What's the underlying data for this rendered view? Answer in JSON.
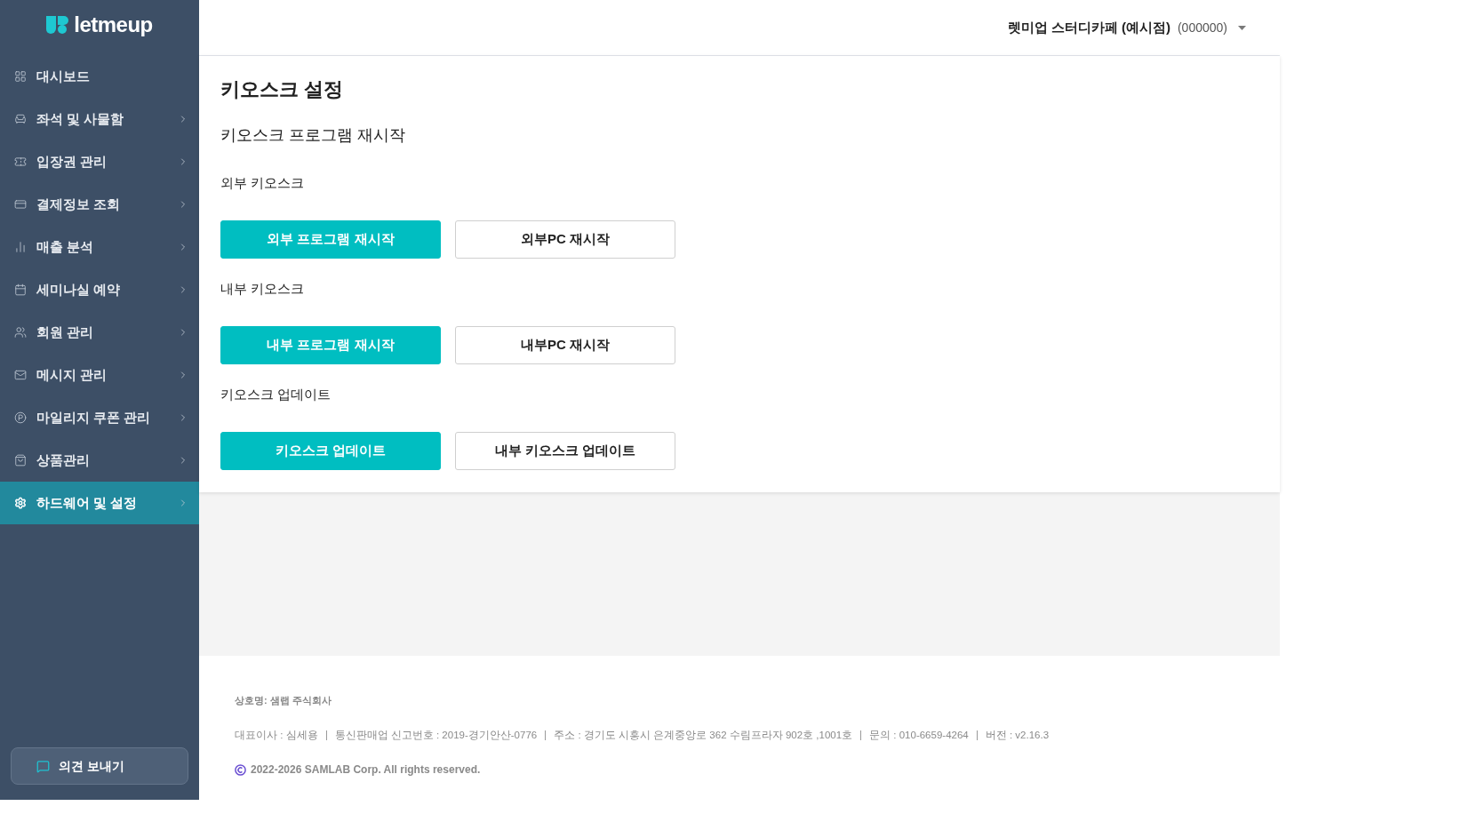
{
  "sidebar": {
    "logo": {
      "text": "letmeup"
    },
    "items": [
      {
        "label": "대시보드",
        "kind": "link",
        "selected": false
      },
      {
        "label": "좌석 및 사물함",
        "kind": "group",
        "selected": false
      },
      {
        "label": "입장권 관리",
        "kind": "group",
        "selected": false
      },
      {
        "label": "결제정보 조회",
        "kind": "group",
        "selected": false
      },
      {
        "label": "매출 분석",
        "kind": "group",
        "selected": false
      },
      {
        "label": "세미나실 예약",
        "kind": "group",
        "selected": false
      },
      {
        "label": "회원 관리",
        "kind": "group",
        "selected": false
      },
      {
        "label": "메시지 관리",
        "kind": "group",
        "selected": false
      },
      {
        "label": "마일리지 쿠폰 관리",
        "kind": "group",
        "selected": false
      },
      {
        "label": "상품관리",
        "kind": "group",
        "selected": false
      },
      {
        "label": "하드웨어 및 설정",
        "kind": "group",
        "selected": true
      }
    ],
    "feedback_button": {
      "label": "의견 보내기"
    }
  },
  "header": {
    "store_name": "렛미업 스터디카페 (예시점)",
    "store_code": "(000000)"
  },
  "page": {
    "title": "키오스크 설정",
    "subtitle": "키오스크 프로그램 재시작",
    "sections": [
      {
        "label": "외부 키오스크",
        "buttons": [
          {
            "label": "외부 프로그램 재시작",
            "kind": "primary"
          },
          {
            "label": "외부PC 재시작",
            "kind": "outline"
          }
        ]
      },
      {
        "label": "내부 키오스크",
        "buttons": [
          {
            "label": "내부 프로그램 재시작",
            "kind": "primary"
          },
          {
            "label": "내부PC 재시작",
            "kind": "outline"
          }
        ]
      },
      {
        "label": "키오스크 업데이트",
        "buttons": [
          {
            "label": "키오스크 업데이트",
            "kind": "primary"
          },
          {
            "label": "내부 키오스크 업데이트",
            "kind": "outline"
          }
        ]
      }
    ]
  },
  "footer": {
    "company": "상호명: 샘랩 주식회사",
    "info": [
      "대표이사 : 심세용",
      "통신판매업 신고번호 : 2019-경기안산-0776",
      "주소 : 경기도 시흥시 은계중앙로 362 수림프라자 902호 ,1001호",
      "문의 : 010-6659-4264",
      "버전 : v2.16.3"
    ],
    "copyright": "2022-2026 SAMLAB Corp. All rights reserved."
  }
}
